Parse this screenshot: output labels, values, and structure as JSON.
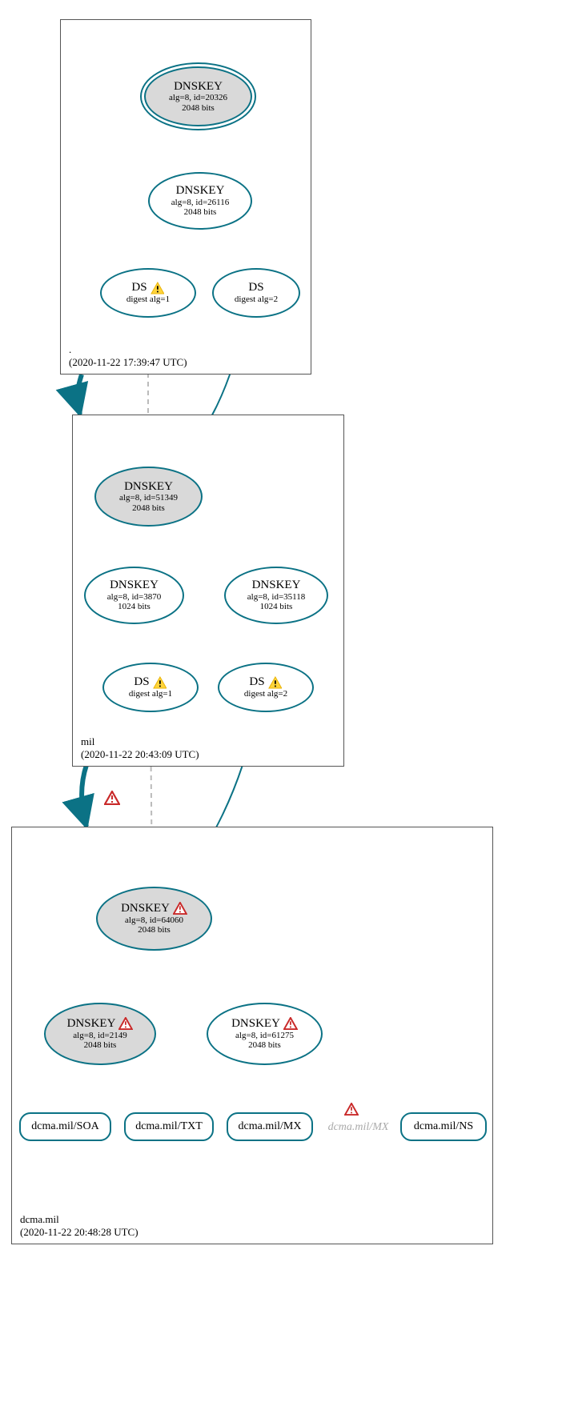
{
  "zones": {
    "root": {
      "name": ".",
      "timestamp": "(2020-11-22 17:39:47 UTC)"
    },
    "mil": {
      "name": "mil",
      "timestamp": "(2020-11-22 20:43:09 UTC)"
    },
    "dcma": {
      "name": "dcma.mil",
      "timestamp": "(2020-11-22 20:48:28 UTC)"
    }
  },
  "nodes": {
    "root_ksk": {
      "title": "DNSKEY",
      "alg": "alg=8, id=20326",
      "bits": "2048 bits"
    },
    "root_zsk": {
      "title": "DNSKEY",
      "alg": "alg=8, id=26116",
      "bits": "2048 bits"
    },
    "root_ds1": {
      "title": "DS",
      "digest": "digest alg=1"
    },
    "root_ds2": {
      "title": "DS",
      "digest": "digest alg=2"
    },
    "mil_ksk": {
      "title": "DNSKEY",
      "alg": "alg=8, id=51349",
      "bits": "2048 bits"
    },
    "mil_zsk1": {
      "title": "DNSKEY",
      "alg": "alg=8, id=3870",
      "bits": "1024 bits"
    },
    "mil_zsk2": {
      "title": "DNSKEY",
      "alg": "alg=8, id=35118",
      "bits": "1024 bits"
    },
    "mil_ds1": {
      "title": "DS",
      "digest": "digest alg=1"
    },
    "mil_ds2": {
      "title": "DS",
      "digest": "digest alg=2"
    },
    "dcma_ksk": {
      "title": "DNSKEY",
      "alg": "alg=8, id=64060",
      "bits": "2048 bits"
    },
    "dcma_zsk1": {
      "title": "DNSKEY",
      "alg": "alg=8, id=2149",
      "bits": "2048 bits"
    },
    "dcma_zsk2": {
      "title": "DNSKEY",
      "alg": "alg=8, id=61275",
      "bits": "2048 bits"
    }
  },
  "rr": {
    "soa": "dcma.mil/SOA",
    "txt": "dcma.mil/TXT",
    "mx": "dcma.mil/MX",
    "mx_ghost": "dcma.mil/MX",
    "ns": "dcma.mil/NS"
  },
  "colors": {
    "teal": "#0b7285",
    "grey": "#bbbbbb"
  }
}
